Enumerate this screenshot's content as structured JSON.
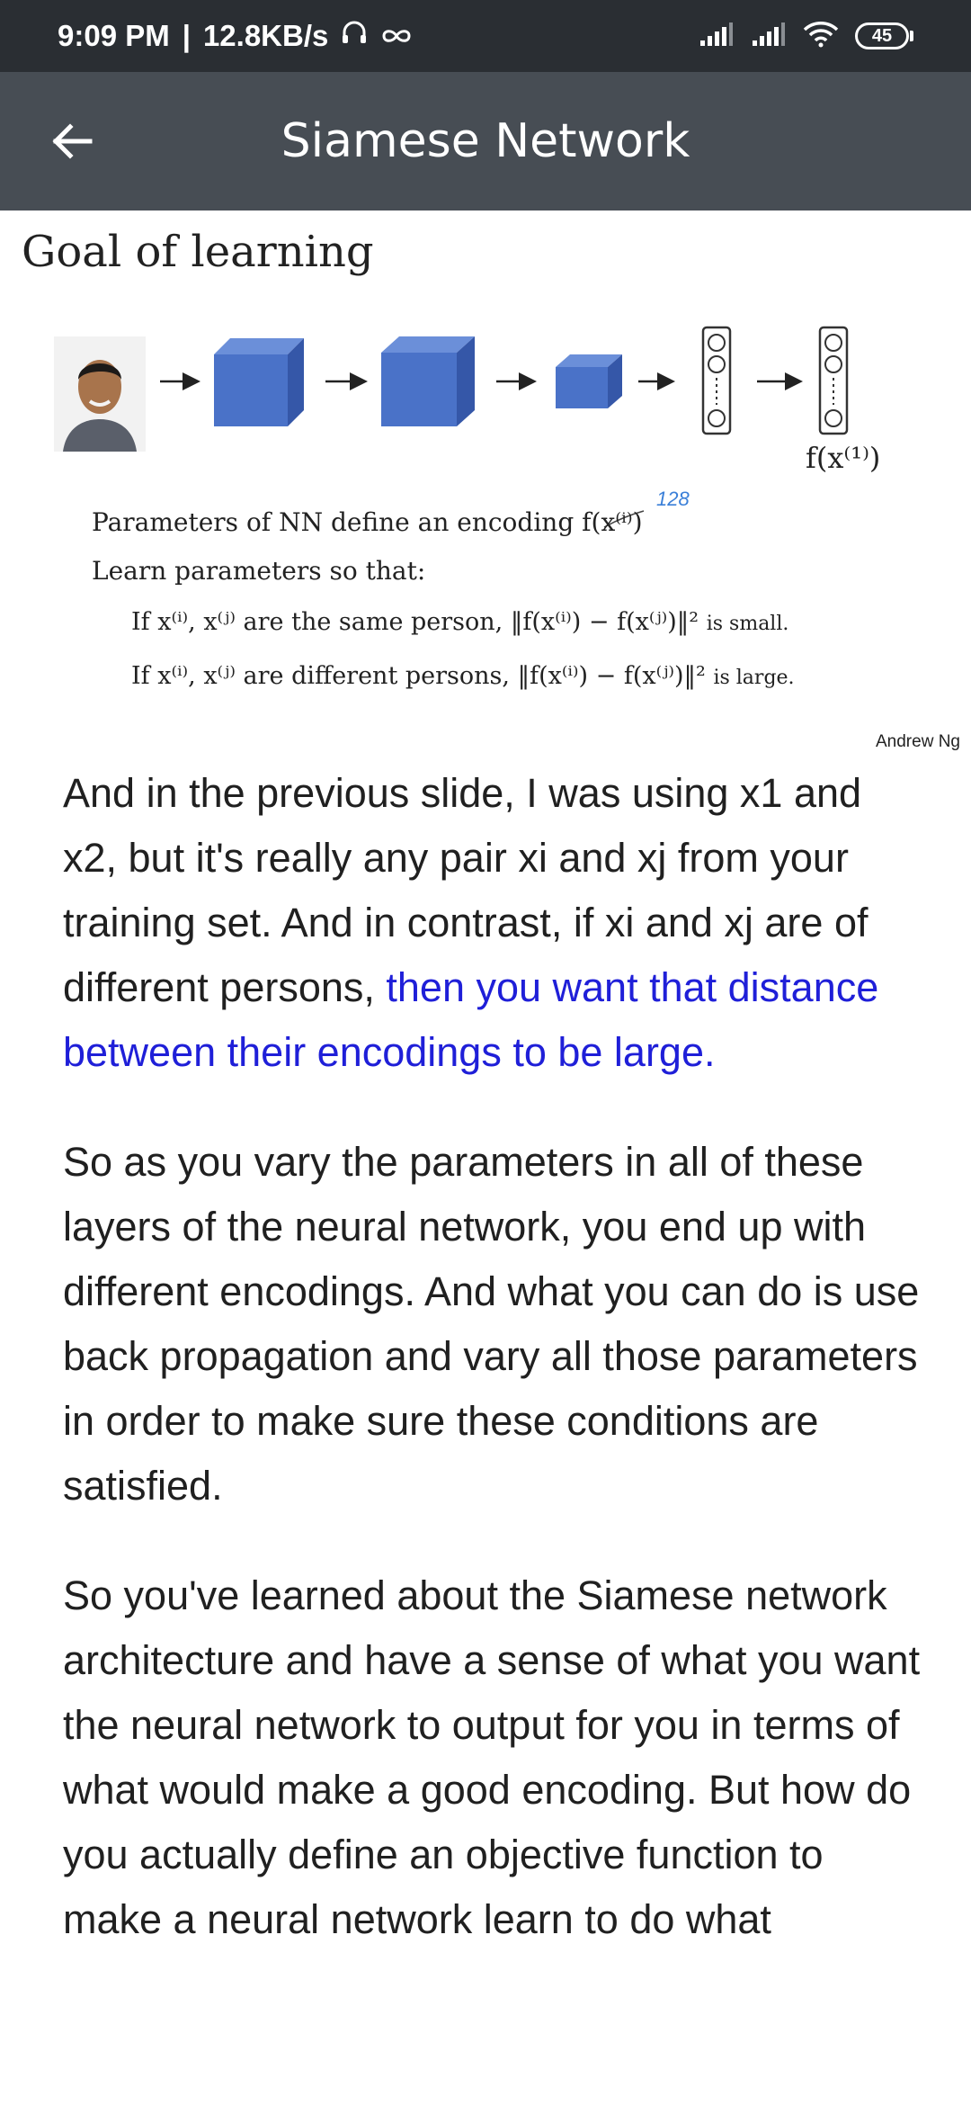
{
  "status": {
    "time": "9:09 PM",
    "speed": "12.8KB/s",
    "battery": "45"
  },
  "app_bar": {
    "title": "Siamese Network"
  },
  "slide": {
    "title": "Goal of learning",
    "output_label": "f(x⁽¹⁾)",
    "line1": "Parameters of NN define an encoding f(x⁽ⁱ⁾)",
    "handwritten_note": "128",
    "line2": "Learn parameters so that:",
    "line3_prefix": "If x⁽ⁱ⁾, x⁽ʲ⁾ are the same person, ‖f(x⁽ⁱ⁾) − f(x⁽ʲ⁾)‖²",
    "line3_suffix": "is small.",
    "line4_prefix": "If x⁽ⁱ⁾, x⁽ʲ⁾ are different persons, ‖f(x⁽ⁱ⁾) − f(x⁽ʲ⁾)‖²",
    "line4_suffix": "is large.",
    "credit": "Andrew Ng"
  },
  "transcript": {
    "p1_normal": "And in the previous slide, I was using x1 and x2, but it's really any pair xi and xj from your training set. And in contrast, if xi and xj are of different persons, ",
    "p1_highlight": "then you want that distance between their encodings to be large.",
    "p2": "So as you vary the parameters in all of these layers of the neural network, you end up with different encodings. And what you can do is use back propagation and vary all those parameters in order to make sure these conditions are satisfied.",
    "p3": "So you've learned about the Siamese network architecture and have a sense of what you want the neural network to output for you in terms of what would make a good encoding. But how do you actually define an objective function to make a neural network learn to do what"
  }
}
